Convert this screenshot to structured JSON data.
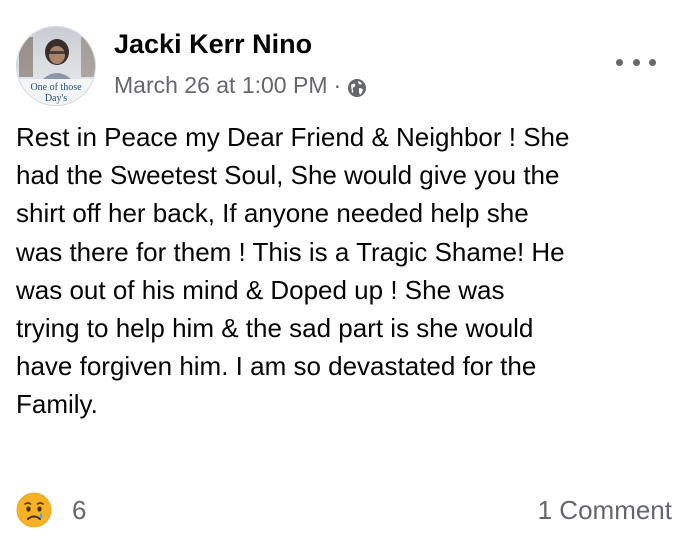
{
  "post": {
    "author": {
      "name": "Jacki Kerr Nino",
      "avatar_caption_line1": "One of those",
      "avatar_caption_line2": "Day's"
    },
    "timestamp": "March 26 at 1:00 PM",
    "separator": "·",
    "privacy_icon": "globe-icon",
    "more_icon": "more-options-icon",
    "text": "Rest in Peace my Dear Friend & Neighbor ! She\nhad the Sweetest Soul, She would give you the\nshirt off her back, If anyone needed help she\nwas there for them ! This is a Tragic Shame! He\nwas out of his mind & Doped up ! She was\ntrying to help him & the sad part is she would\nhave forgiven him. I am so devastated for the\nFamily.",
    "reactions": {
      "icon": "sad-reaction-icon",
      "count": "6"
    },
    "comments_label": "1 Comment"
  },
  "colors": {
    "primary_text": "#050505",
    "secondary_text": "#65676b",
    "reaction_yellow": "#f7b125",
    "tear_blue": "#4aa3f0"
  }
}
